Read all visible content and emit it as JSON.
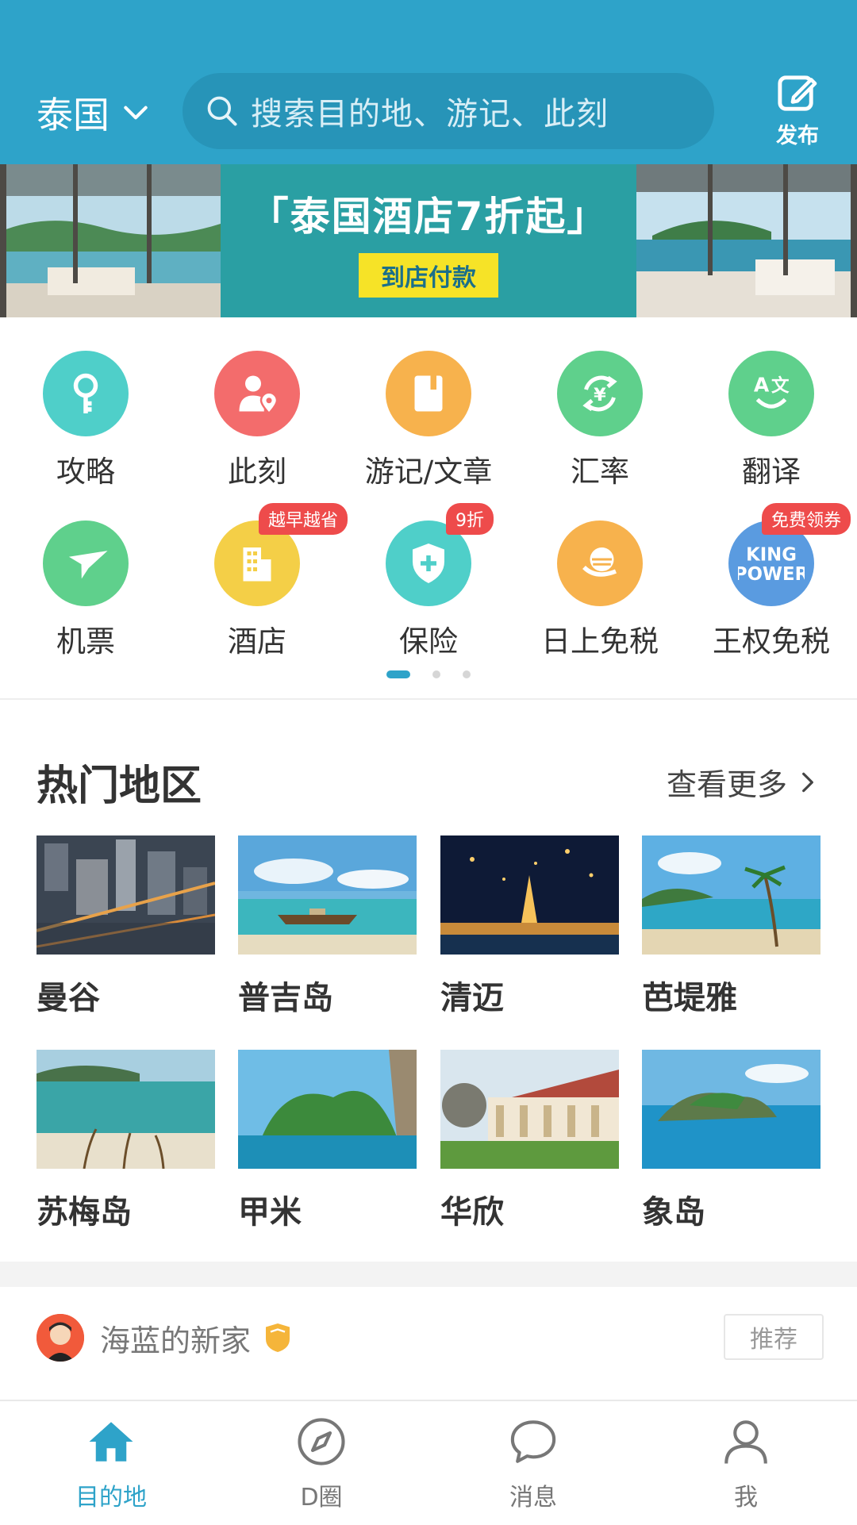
{
  "header": {
    "region": "泰国",
    "search_placeholder": "搜索目的地、游记、此刻",
    "publish_label": "发布"
  },
  "banner": {
    "headline": "「泰国酒店7折起」",
    "pay_label": "到店付款"
  },
  "quick_grid": [
    {
      "label": "攻略",
      "icon": "key-icon",
      "color": "#4fcfc9"
    },
    {
      "label": "此刻",
      "icon": "person-location-icon",
      "color": "#f36c6c"
    },
    {
      "label": "游记/文章",
      "icon": "book-icon",
      "color": "#f7b24d"
    },
    {
      "label": "汇率",
      "icon": "currency-exchange-icon",
      "color": "#5fd08c"
    },
    {
      "label": "翻译",
      "icon": "translate-icon",
      "color": "#5fd08c"
    },
    {
      "label": "机票",
      "icon": "airplane-icon",
      "color": "#5fd08c"
    },
    {
      "label": "酒店",
      "icon": "hotel-building-icon",
      "color": "#f4cf47",
      "badge": "越早越省"
    },
    {
      "label": "保险",
      "icon": "shield-plus-icon",
      "color": "#4fcfc9",
      "badge": "9折"
    },
    {
      "label": "日上免税",
      "icon": "duty-free-sun-icon",
      "color": "#f7b24d"
    },
    {
      "label": "王权免税",
      "icon": "king-power-logo",
      "color": "#5a9be0",
      "badge": "免费领券",
      "logo_text": "KING POWER"
    }
  ],
  "hot": {
    "title": "热门地区",
    "more": "查看更多",
    "destinations": [
      {
        "name": "曼谷"
      },
      {
        "name": "普吉岛"
      },
      {
        "name": "清迈"
      },
      {
        "name": "芭堤雅"
      },
      {
        "name": "苏梅岛"
      },
      {
        "name": "甲米"
      },
      {
        "name": "华欣"
      },
      {
        "name": "象岛"
      }
    ]
  },
  "feed": {
    "username": "海蓝的新家",
    "recommend_label": "推荐"
  },
  "tabbar": [
    {
      "label": "目的地",
      "icon": "home-icon",
      "active": true
    },
    {
      "label": "D圈",
      "icon": "compass-icon",
      "active": false
    },
    {
      "label": "消息",
      "icon": "chat-bubble-icon",
      "active": false
    },
    {
      "label": "我",
      "icon": "user-icon",
      "active": false
    }
  ],
  "colors": {
    "primary": "#2ea3c9",
    "badge": "#ee4b4b",
    "pay_bg": "#f6e327"
  }
}
